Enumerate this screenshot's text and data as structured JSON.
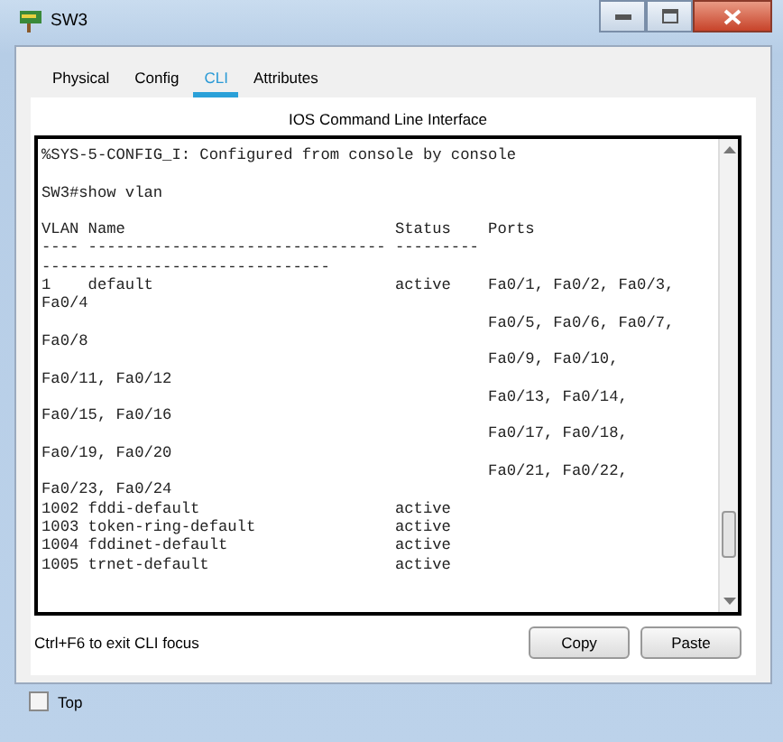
{
  "window": {
    "title": "SW3"
  },
  "tabs": [
    {
      "label": "Physical",
      "selected": false
    },
    {
      "label": "Config",
      "selected": false
    },
    {
      "label": "CLI",
      "selected": true
    },
    {
      "label": "Attributes",
      "selected": false
    }
  ],
  "cli": {
    "heading": "IOS Command Line Interface",
    "lines": [
      {
        "text": "%SYS-5-CONFIG_I: Configured from console by console",
        "gap_before": false
      },
      {
        "text": "SW3#show vlan",
        "gap_before": true
      },
      {
        "text": "VLAN Name                             Status    Ports",
        "gap_before": true
      },
      {
        "text": "---- -------------------------------- --------- ",
        "gap_before": false
      },
      {
        "text": "-------------------------------",
        "gap_before": false
      },
      {
        "text": "1    default                          active    Fa0/1, Fa0/2, Fa0/3,",
        "gap_before": false
      },
      {
        "text": "Fa0/4",
        "gap_before": false
      },
      {
        "text": "                                                Fa0/5, Fa0/6, Fa0/7,",
        "gap_before": false
      },
      {
        "text": "Fa0/8",
        "gap_before": false
      },
      {
        "text": "                                                Fa0/9, Fa0/10,",
        "gap_before": false
      },
      {
        "text": "Fa0/11, Fa0/12",
        "gap_before": false
      },
      {
        "text": "                                                Fa0/13, Fa0/14,",
        "gap_before": false
      },
      {
        "text": "Fa0/15, Fa0/16",
        "gap_before": false
      },
      {
        "text": "                                                Fa0/17, Fa0/18,",
        "gap_before": false
      },
      {
        "text": "Fa0/19, Fa0/20",
        "gap_before": false
      },
      {
        "text": "                                                Fa0/21, Fa0/22,",
        "gap_before": false
      },
      {
        "text": "Fa0/23, Fa0/24",
        "gap_before": false
      },
      {
        "text": "1002 fddi-default                     active",
        "gap_before": false
      },
      {
        "text": "1003 token-ring-default               active",
        "gap_before": false
      },
      {
        "text": "1004 fddinet-default                  active",
        "gap_before": false
      },
      {
        "text": "1005 trnet-default                    active",
        "gap_before": false
      }
    ]
  },
  "hint": "Ctrl+F6 to exit CLI focus",
  "buttons": [
    "Copy",
    "Paste"
  ],
  "top_checkbox": {
    "label": "Top",
    "checked": false
  }
}
